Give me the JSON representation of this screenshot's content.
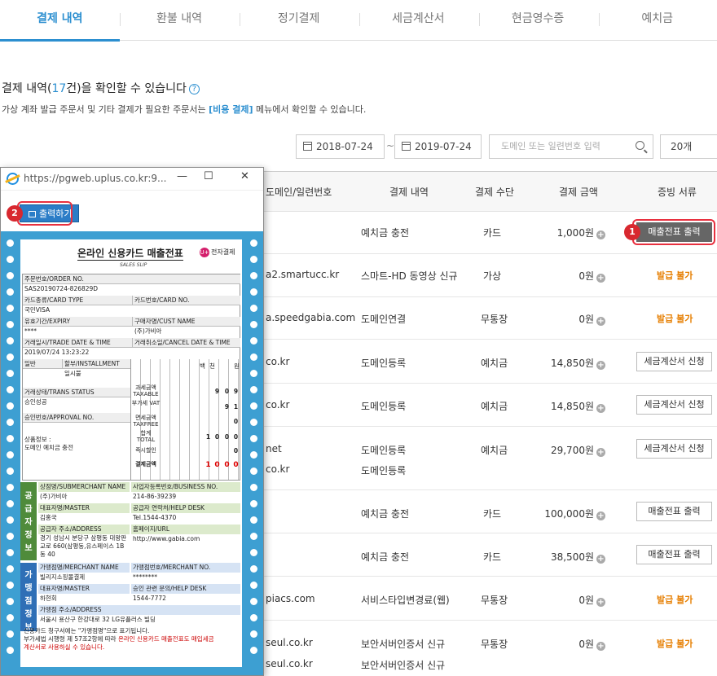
{
  "tabs": [
    {
      "label": "결제 내역",
      "active": true
    },
    {
      "label": "환불 내역"
    },
    {
      "label": "정기결제"
    },
    {
      "label": "세금계산서"
    },
    {
      "label": "현금영수증"
    },
    {
      "label": "예치금"
    }
  ],
  "headline": {
    "prefix": "결제 내역(",
    "count": "17",
    "suffix": "건)을 확인할 수 있습니다"
  },
  "subline": {
    "prefix": "가상 계좌 발급 주문서 및 기타 결제가 필요한 주문서는 ",
    "link": "[비용 결제]",
    "suffix": " 메뉴에서 확인할 수 있습니다."
  },
  "filter": {
    "date_from": "2018-07-24",
    "tilde": "~",
    "date_to": "2019-07-24",
    "search_placeholder": "도메인 또는 일련번호 입력",
    "page_size": "20개"
  },
  "table": {
    "headers": [
      "도메인/일련번호",
      "결제 내역",
      "결제 수단",
      "결제 금액",
      "증빙 서류"
    ],
    "rows": [
      {
        "domain": "",
        "desc": "예치금 충전",
        "method": "카드",
        "amount": "1,000원",
        "action": "매출전표 출력",
        "action_type": "dark"
      },
      {
        "domain": "a2.smartucc.kr",
        "desc": "스마트-HD 동영상 신규",
        "method": "가상",
        "amount": "0원",
        "action": "발급 불가",
        "action_type": "na"
      },
      {
        "domain": "a.speedgabia.com",
        "desc": "도메인연결",
        "method": "무통장",
        "amount": "0원",
        "action": "발급 불가",
        "action_type": "na"
      },
      {
        "domain": "co.kr",
        "desc": "도메인등록",
        "method": "예치금",
        "amount": "14,850원",
        "action": "세금계산서 신청",
        "action_type": "btn"
      },
      {
        "domain": "co.kr",
        "desc": "도메인등록",
        "method": "예치금",
        "amount": "14,850원",
        "action": "세금계산서 신청",
        "action_type": "btn"
      },
      {
        "domain": "net",
        "domain2": "co.kr",
        "desc": "도메인등록",
        "desc2": "도메인등록",
        "method": "예치금",
        "amount": "29,700원",
        "action": "세금계산서 신청",
        "action_type": "btn"
      },
      {
        "domain": "",
        "desc": "예치금 충전",
        "method": "카드",
        "amount": "100,000원",
        "action": "매출전표 출력",
        "action_type": "btn"
      },
      {
        "domain": "",
        "desc": "예치금 충전",
        "method": "카드",
        "amount": "38,500원",
        "action": "매출전표 출력",
        "action_type": "btn"
      },
      {
        "domain": "piacs.com",
        "desc": "서비스타입변경료(웹)",
        "method": "무통장",
        "amount": "0원",
        "action": "발급 불가",
        "action_type": "na"
      },
      {
        "domain": "seul.co.kr",
        "domain2": "seul.co.kr",
        "desc": "보안서버인증서 신규",
        "desc2": "보안서버인증서 신규",
        "method": "무통장",
        "amount": "0원",
        "action": "발급 불가",
        "action_type": "na"
      }
    ]
  },
  "callouts": {
    "one": "1",
    "two": "2"
  },
  "popup": {
    "url": "https://pgweb.uplus.co.kr:9...",
    "minimize": "—",
    "maximize": "☐",
    "close": "✕",
    "print_label": "출력하기"
  },
  "receipt": {
    "title": "온라인 신용카드 매출전표",
    "subtitle": "SALES SLIP",
    "logo_text": "전자결제",
    "logo_mark": "U+",
    "order_no_label": "주문번호/ORDER NO.",
    "order_no": "SAS20190724-826829D",
    "card_type_label": "카드종류/CARD TYPE",
    "card_type": "국민VISA",
    "card_no_label": "카드번호/CARD NO.",
    "expiry_label": "유효기간/EXPIRY",
    "expiry": "****",
    "cust_label": "구매자명/CUST NAME",
    "cust": "(주)가비아",
    "trade_date_label": "거래일시/TRADE DATE & TIME",
    "trade_date": "2019/07/24 13:23:22",
    "cancel_date_label": "거래취소일/CANCEL DATE & TIME",
    "type_label": "일반",
    "install_label": "할부/INSTALLMENT",
    "install": "일시불",
    "unit_baek": "백",
    "unit_cheon": "천",
    "unit_won": "원",
    "status_label": "거래상태/TRANS STATUS",
    "status": "승인성공",
    "approval_label": "승인번호/APPROVAL NO.",
    "product_label": "상품정보 :",
    "product": "도메인 예치금 충전",
    "taxable_label": "과세금액 TAXABLE",
    "vat_label": "부가세 VAT",
    "taxfree_label": "면세금액 TAXFREE",
    "total_label": "합계 TOTAL",
    "discount_label": "즉시할인",
    "paid_label": "결제금액",
    "taxable_digits": [
      "9",
      "0",
      "9"
    ],
    "vat_digits": [
      "9",
      "1"
    ],
    "taxfree_digits": [
      "0"
    ],
    "total_digits": [
      "1",
      "0",
      "0",
      "0"
    ],
    "discount_digits": [
      "0"
    ],
    "paid_digits": [
      "1",
      "0",
      "0",
      "0"
    ],
    "seller_bar": "공급자정보",
    "merchant_bar": "가맹점정보",
    "seller_name_label": "상점명/SUBMERCHANT NAME",
    "seller_name": "(주)가비아",
    "biz_no_label": "사업자등록번호/BUSINESS NO.",
    "biz_no": "214-86-39239",
    "master_label": "대표자명/MASTER",
    "master": "김홍국",
    "help_label": "공급자 연락처/HELP DESK",
    "help": "Tel.1544-4370",
    "address_label": "공급자 주소/ADDRESS",
    "address": "경기 성남시 분당구 삼평동 대왕판교로 660(삼평동,유스페이스 1B동 40",
    "url_label": "홈페이지/URL",
    "url": "http://www.gabia.com",
    "m_name_label": "가맹점명/MERCHANT NAME",
    "m_name": "빌리지소핑몰결제",
    "m_no_label": "가맹점번호/MERCHANT NO.",
    "m_no": "********",
    "m_master_label": "대표자명/MASTER",
    "m_master": "하현회",
    "m_help_label": "승인 관련 문의/HELP DESK",
    "m_help": "1544-7772",
    "m_addr_label": "가맹점 주소/ADDRESS",
    "m_addr": "서울시 용산구 한강대로 32 LG유플러스 빌딩",
    "note1": "신용카드 청구서에는 \"가맹점명\"으로 표기됩니다.",
    "note2_a": "부가세법 시행령 제 57조2항에 따라 ",
    "note2_red": "온라인 신용카드 매출전표도 매입세금",
    "note3_red": "계산서로 사용하실 수 있습니다."
  }
}
